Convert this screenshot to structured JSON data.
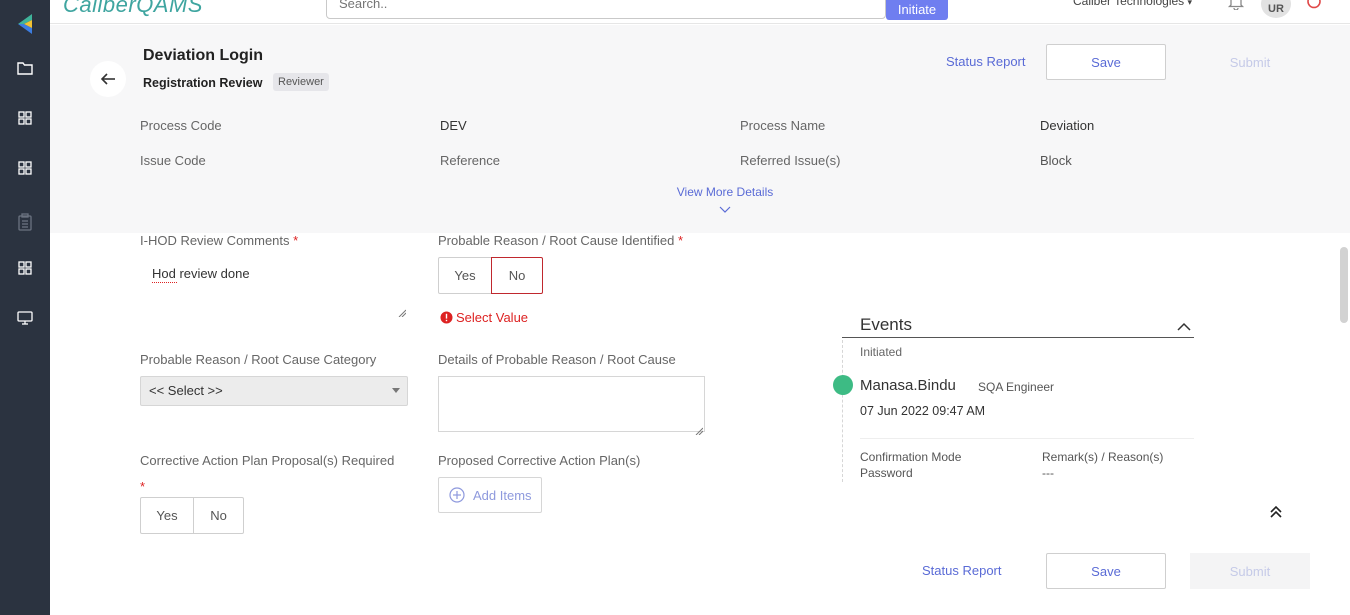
{
  "app": {
    "logo_text": "CaliberQAMS",
    "search_placeholder": "Search..",
    "initiate_label": "Initiate",
    "company": "Caliber Technologies",
    "user_initials": "UR"
  },
  "header": {
    "title": "Deviation Login",
    "stage": "Registration Review",
    "role_badge": "Reviewer",
    "status_report_label": "Status Report",
    "save_label": "Save",
    "submit_label": "Submit",
    "meta": {
      "process_code_label": "Process Code",
      "process_code_value": "DEV",
      "process_name_label": "Process Name",
      "process_name_value": "Deviation",
      "issue_code_label": "Issue Code",
      "reference_label": "Reference",
      "referred_issues_label": "Referred Issue(s)",
      "block_label": "Block"
    },
    "view_more_label": "View More Details"
  },
  "form": {
    "ihod_label": "I-HOD Review Comments",
    "ihod_value": "Hod review done",
    "probable_reason_label": "Probable Reason / Root Cause Identified",
    "yes_label": "Yes",
    "no_label": "No",
    "error_text": "Select Value",
    "category_label": "Probable Reason / Root Cause Category",
    "category_value": "<< Select >>",
    "details_label": "Details of Probable Reason / Root Cause",
    "capa_required_label": "Corrective Action Plan Proposal(s) Required",
    "proposed_capa_label": "Proposed Corrective Action Plan(s)",
    "add_items_label": "Add Items",
    "required_mark": "*"
  },
  "events": {
    "title": "Events",
    "stage": "Initiated",
    "user": "Manasa.Bindu",
    "role": "SQA Engineer",
    "date": "07 Jun 2022 09:47 AM",
    "confirmation_label": "Confirmation Mode",
    "confirmation_value": "Password",
    "remarks_label": "Remark(s) / Reason(s)",
    "remarks_value": "---"
  },
  "footer": {
    "status_report_label": "Status Report",
    "save_label": "Save",
    "submit_label": "Submit"
  },
  "colors": {
    "sidebar": "#2b3340",
    "accent": "#5a6bd6",
    "initiate": "#6f7ef0",
    "error": "#d22222",
    "event_dot": "#3dbb84"
  }
}
